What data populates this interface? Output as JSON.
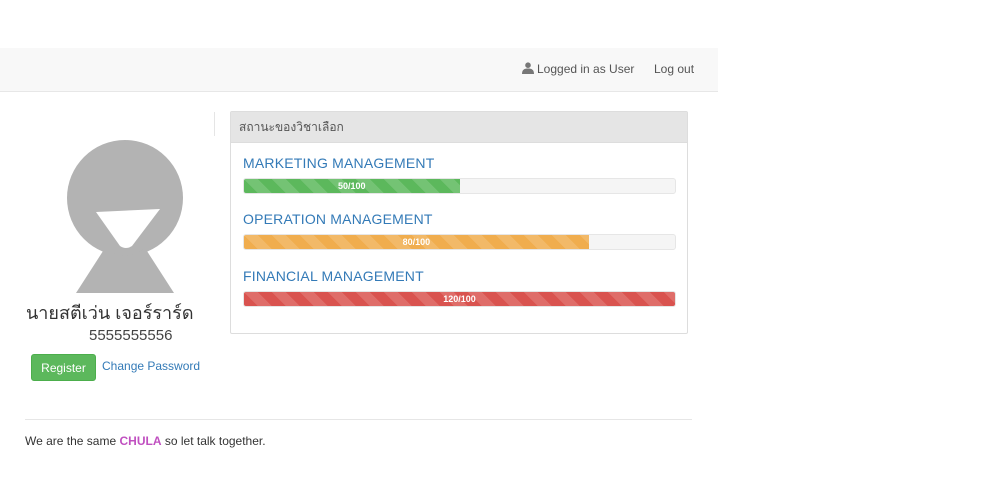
{
  "navbar": {
    "user_label": "Logged in as User",
    "logout_label": "Log out"
  },
  "profile": {
    "name": "นายสตีเว่น เจอร์ราร์ด",
    "student_id": "5555555556",
    "register_label": "Register",
    "change_password_label": "Change Password"
  },
  "panel": {
    "title": "สถานะของวิชาเลือก",
    "courses": [
      {
        "name": "MARKETING MANAGEMENT",
        "progress_text": "50/100",
        "value": 50,
        "max": 100,
        "status": "success"
      },
      {
        "name": "OPERATION MANAGEMENT",
        "progress_text": "80/100",
        "value": 80,
        "max": 100,
        "status": "warning"
      },
      {
        "name": "FINANCIAL MANAGEMENT",
        "progress_text": "120/100",
        "value": 120,
        "max": 100,
        "status": "danger"
      }
    ]
  },
  "footer": {
    "prefix": "We are the same",
    "brand": "CHULA",
    "suffix": "so let talk together."
  },
  "colors": {
    "success": "#5cb85c",
    "warning": "#f0ad4e",
    "danger": "#d9534f",
    "link": "#337ab7",
    "brand": "#c050c0"
  },
  "icons": {
    "user": "user-icon",
    "avatar": "default-avatar"
  }
}
